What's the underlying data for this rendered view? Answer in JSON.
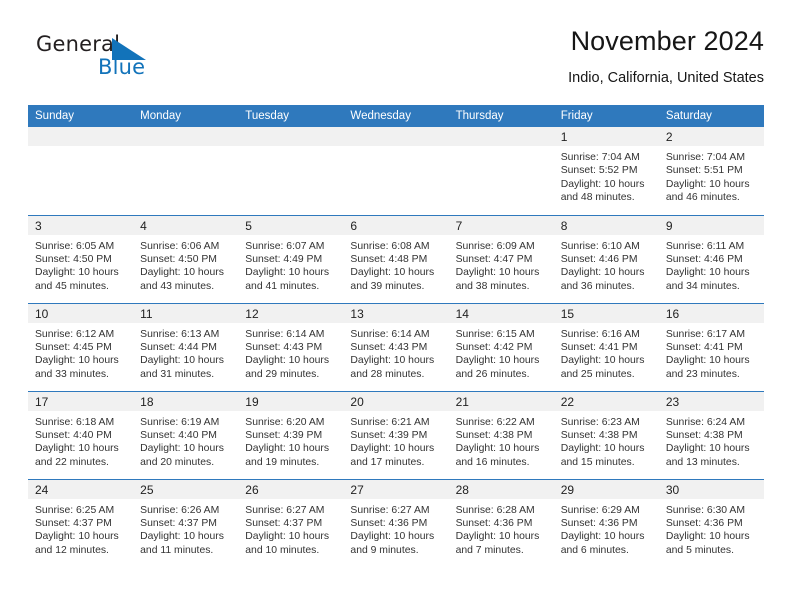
{
  "brand": {
    "name_part1": "General",
    "name_part2": "Blue",
    "triangle_color": "#1273ba"
  },
  "header": {
    "title": "November 2024",
    "subtitle": "Indio, California, United States"
  },
  "colors": {
    "header_blue": "#2f79bd",
    "daynum_band": "#f1f1f1",
    "text": "#333333"
  },
  "calendar": {
    "weekdays": [
      "Sunday",
      "Monday",
      "Tuesday",
      "Wednesday",
      "Thursday",
      "Friday",
      "Saturday"
    ],
    "weeks": [
      [
        {
          "day": "",
          "sunrise": "",
          "sunset": "",
          "daylight": ""
        },
        {
          "day": "",
          "sunrise": "",
          "sunset": "",
          "daylight": ""
        },
        {
          "day": "",
          "sunrise": "",
          "sunset": "",
          "daylight": ""
        },
        {
          "day": "",
          "sunrise": "",
          "sunset": "",
          "daylight": ""
        },
        {
          "day": "",
          "sunrise": "",
          "sunset": "",
          "daylight": ""
        },
        {
          "day": "1",
          "sunrise": "Sunrise: 7:04 AM",
          "sunset": "Sunset: 5:52 PM",
          "daylight": "Daylight: 10 hours and 48 minutes."
        },
        {
          "day": "2",
          "sunrise": "Sunrise: 7:04 AM",
          "sunset": "Sunset: 5:51 PM",
          "daylight": "Daylight: 10 hours and 46 minutes."
        }
      ],
      [
        {
          "day": "3",
          "sunrise": "Sunrise: 6:05 AM",
          "sunset": "Sunset: 4:50 PM",
          "daylight": "Daylight: 10 hours and 45 minutes."
        },
        {
          "day": "4",
          "sunrise": "Sunrise: 6:06 AM",
          "sunset": "Sunset: 4:50 PM",
          "daylight": "Daylight: 10 hours and 43 minutes."
        },
        {
          "day": "5",
          "sunrise": "Sunrise: 6:07 AM",
          "sunset": "Sunset: 4:49 PM",
          "daylight": "Daylight: 10 hours and 41 minutes."
        },
        {
          "day": "6",
          "sunrise": "Sunrise: 6:08 AM",
          "sunset": "Sunset: 4:48 PM",
          "daylight": "Daylight: 10 hours and 39 minutes."
        },
        {
          "day": "7",
          "sunrise": "Sunrise: 6:09 AM",
          "sunset": "Sunset: 4:47 PM",
          "daylight": "Daylight: 10 hours and 38 minutes."
        },
        {
          "day": "8",
          "sunrise": "Sunrise: 6:10 AM",
          "sunset": "Sunset: 4:46 PM",
          "daylight": "Daylight: 10 hours and 36 minutes."
        },
        {
          "day": "9",
          "sunrise": "Sunrise: 6:11 AM",
          "sunset": "Sunset: 4:46 PM",
          "daylight": "Daylight: 10 hours and 34 minutes."
        }
      ],
      [
        {
          "day": "10",
          "sunrise": "Sunrise: 6:12 AM",
          "sunset": "Sunset: 4:45 PM",
          "daylight": "Daylight: 10 hours and 33 minutes."
        },
        {
          "day": "11",
          "sunrise": "Sunrise: 6:13 AM",
          "sunset": "Sunset: 4:44 PM",
          "daylight": "Daylight: 10 hours and 31 minutes."
        },
        {
          "day": "12",
          "sunrise": "Sunrise: 6:14 AM",
          "sunset": "Sunset: 4:43 PM",
          "daylight": "Daylight: 10 hours and 29 minutes."
        },
        {
          "day": "13",
          "sunrise": "Sunrise: 6:14 AM",
          "sunset": "Sunset: 4:43 PM",
          "daylight": "Daylight: 10 hours and 28 minutes."
        },
        {
          "day": "14",
          "sunrise": "Sunrise: 6:15 AM",
          "sunset": "Sunset: 4:42 PM",
          "daylight": "Daylight: 10 hours and 26 minutes."
        },
        {
          "day": "15",
          "sunrise": "Sunrise: 6:16 AM",
          "sunset": "Sunset: 4:41 PM",
          "daylight": "Daylight: 10 hours and 25 minutes."
        },
        {
          "day": "16",
          "sunrise": "Sunrise: 6:17 AM",
          "sunset": "Sunset: 4:41 PM",
          "daylight": "Daylight: 10 hours and 23 minutes."
        }
      ],
      [
        {
          "day": "17",
          "sunrise": "Sunrise: 6:18 AM",
          "sunset": "Sunset: 4:40 PM",
          "daylight": "Daylight: 10 hours and 22 minutes."
        },
        {
          "day": "18",
          "sunrise": "Sunrise: 6:19 AM",
          "sunset": "Sunset: 4:40 PM",
          "daylight": "Daylight: 10 hours and 20 minutes."
        },
        {
          "day": "19",
          "sunrise": "Sunrise: 6:20 AM",
          "sunset": "Sunset: 4:39 PM",
          "daylight": "Daylight: 10 hours and 19 minutes."
        },
        {
          "day": "20",
          "sunrise": "Sunrise: 6:21 AM",
          "sunset": "Sunset: 4:39 PM",
          "daylight": "Daylight: 10 hours and 17 minutes."
        },
        {
          "day": "21",
          "sunrise": "Sunrise: 6:22 AM",
          "sunset": "Sunset: 4:38 PM",
          "daylight": "Daylight: 10 hours and 16 minutes."
        },
        {
          "day": "22",
          "sunrise": "Sunrise: 6:23 AM",
          "sunset": "Sunset: 4:38 PM",
          "daylight": "Daylight: 10 hours and 15 minutes."
        },
        {
          "day": "23",
          "sunrise": "Sunrise: 6:24 AM",
          "sunset": "Sunset: 4:38 PM",
          "daylight": "Daylight: 10 hours and 13 minutes."
        }
      ],
      [
        {
          "day": "24",
          "sunrise": "Sunrise: 6:25 AM",
          "sunset": "Sunset: 4:37 PM",
          "daylight": "Daylight: 10 hours and 12 minutes."
        },
        {
          "day": "25",
          "sunrise": "Sunrise: 6:26 AM",
          "sunset": "Sunset: 4:37 PM",
          "daylight": "Daylight: 10 hours and 11 minutes."
        },
        {
          "day": "26",
          "sunrise": "Sunrise: 6:27 AM",
          "sunset": "Sunset: 4:37 PM",
          "daylight": "Daylight: 10 hours and 10 minutes."
        },
        {
          "day": "27",
          "sunrise": "Sunrise: 6:27 AM",
          "sunset": "Sunset: 4:36 PM",
          "daylight": "Daylight: 10 hours and 9 minutes."
        },
        {
          "day": "28",
          "sunrise": "Sunrise: 6:28 AM",
          "sunset": "Sunset: 4:36 PM",
          "daylight": "Daylight: 10 hours and 7 minutes."
        },
        {
          "day": "29",
          "sunrise": "Sunrise: 6:29 AM",
          "sunset": "Sunset: 4:36 PM",
          "daylight": "Daylight: 10 hours and 6 minutes."
        },
        {
          "day": "30",
          "sunrise": "Sunrise: 6:30 AM",
          "sunset": "Sunset: 4:36 PM",
          "daylight": "Daylight: 10 hours and 5 minutes."
        }
      ]
    ]
  }
}
